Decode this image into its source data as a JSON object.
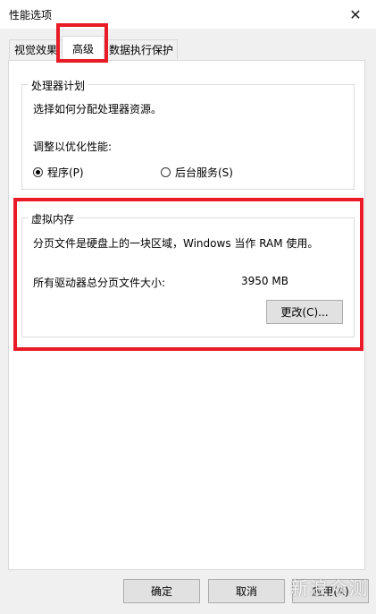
{
  "window": {
    "title": "性能选项",
    "close_glyph": "✕"
  },
  "tabs": [
    {
      "label": "视觉效果"
    },
    {
      "label": "高级"
    },
    {
      "label": "数据执行保护"
    }
  ],
  "processor": {
    "group_title": "处理器计划",
    "description": "选择如何分配处理器资源。",
    "adjust_label": "调整以优化性能:",
    "options": [
      {
        "label": "程序(P)",
        "checked": true
      },
      {
        "label": "后台服务(S)",
        "checked": false
      }
    ]
  },
  "virtual_memory": {
    "group_title": "虚拟内存",
    "description": "分页文件是硬盘上的一块区域，Windows 当作 RAM 使用。",
    "total_label": "所有驱动器总分页文件大小:",
    "total_value": "3950 MB",
    "change_button": "更改(C)..."
  },
  "footer": {
    "ok_button": "确定",
    "cancel_button": "取消",
    "apply_button": "应用(A)"
  },
  "watermark": "新浪众测",
  "colors": {
    "highlight": "#e81b26"
  },
  "icons": {
    "close": "close-icon"
  }
}
